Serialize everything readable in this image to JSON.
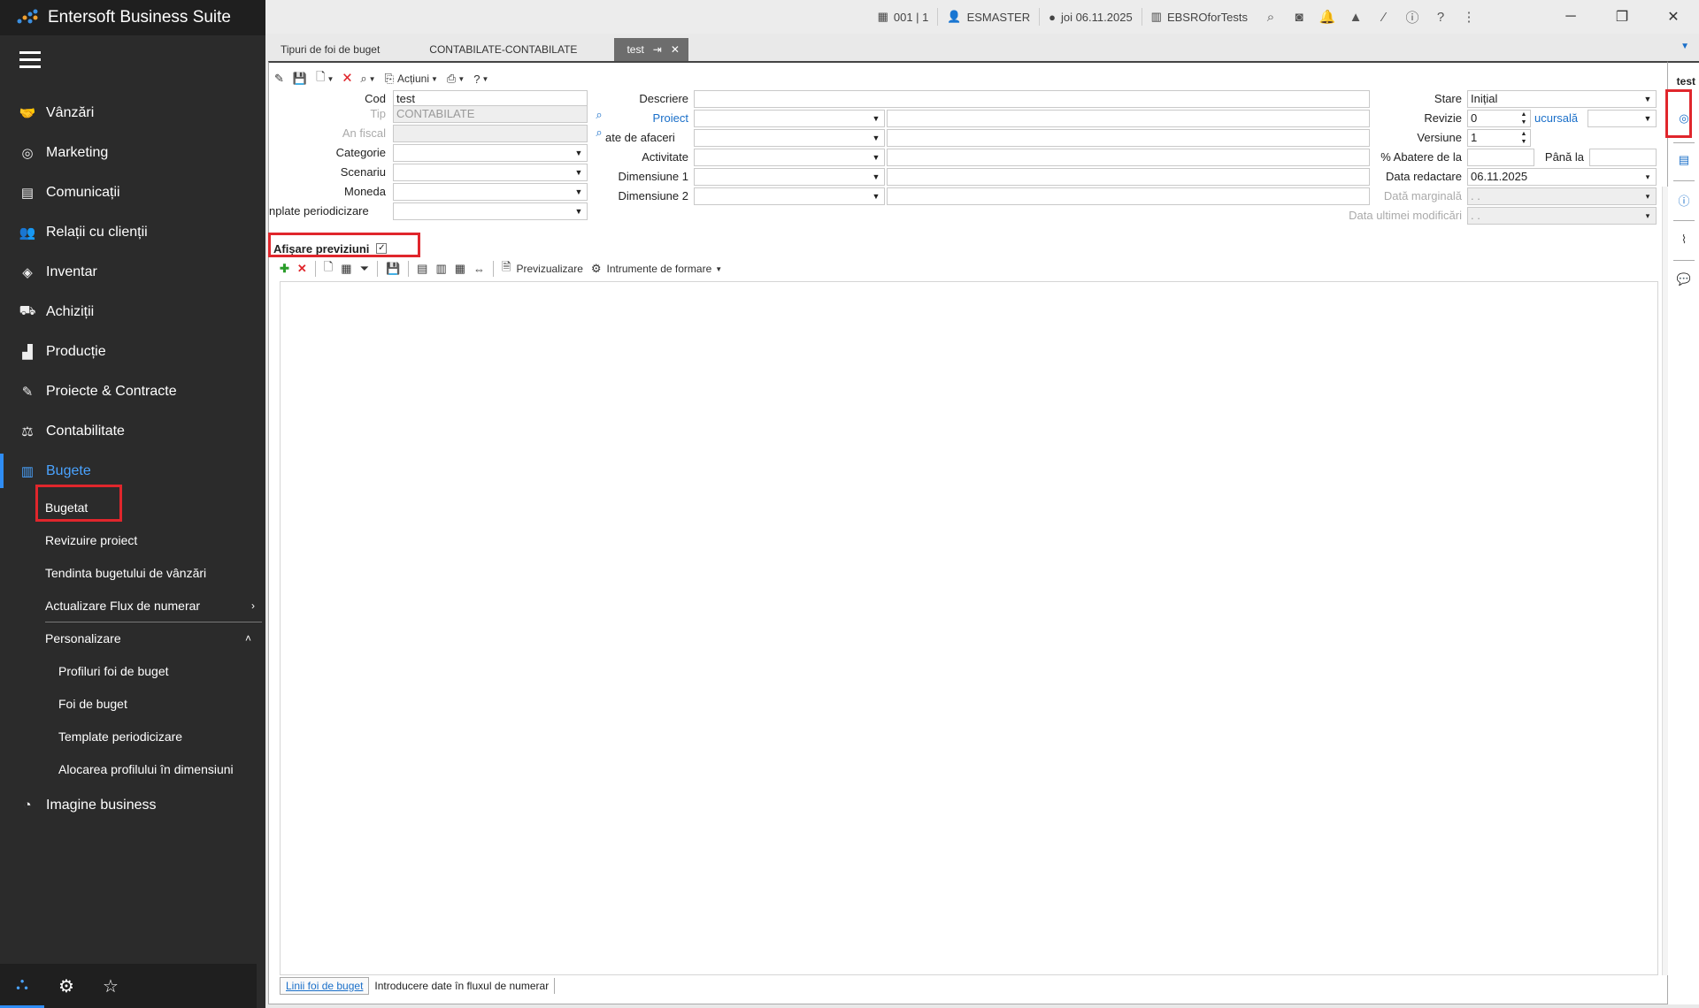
{
  "app": {
    "title": "Entersoft Business Suite"
  },
  "sidebar": {
    "items": [
      {
        "label": "Vânzări",
        "icon": "handshake-icon",
        "glyph": "🤝"
      },
      {
        "label": "Marketing",
        "icon": "target-icon",
        "glyph": "◎"
      },
      {
        "label": "Comunicații",
        "icon": "list-icon",
        "glyph": "▤"
      },
      {
        "label": "Relații cu clienții",
        "icon": "users-icon",
        "glyph": "👥"
      },
      {
        "label": "Inventar",
        "icon": "box-icon",
        "glyph": "◈"
      },
      {
        "label": "Achiziții",
        "icon": "truck-icon",
        "glyph": "⛟"
      },
      {
        "label": "Producție",
        "icon": "factory-icon",
        "glyph": "▟"
      },
      {
        "label": "Proiecte & Contracte",
        "icon": "edit-icon",
        "glyph": "✎"
      },
      {
        "label": "Contabilitate",
        "icon": "money-icon",
        "glyph": "⚖"
      },
      {
        "label": "Bugete",
        "icon": "chart-icon",
        "glyph": "▥"
      }
    ],
    "subitems": [
      {
        "label": "Bugetat"
      },
      {
        "label": "Revizuire proiect"
      },
      {
        "label": "Tendinta bugetului de vânzări"
      },
      {
        "label": "Actualizare Flux de numerar"
      },
      {
        "label": "Personalizare"
      }
    ],
    "subsubitems": [
      {
        "label": "Profiluri foi de buget"
      },
      {
        "label": "Foi de buget"
      },
      {
        "label": "Template periodicizare"
      },
      {
        "label": "Alocarea profilului în dimensiuni"
      }
    ],
    "last_item": {
      "label": "Imagine business",
      "icon": "dashboard-icon",
      "glyph": "◔"
    }
  },
  "titlebar": {
    "company": "001 | 1",
    "user": "ESMASTER",
    "date": "joi 06.11.2025",
    "database": "EBSROforTests"
  },
  "tabs": [
    {
      "label": "Tipuri de foi de buget"
    },
    {
      "label": "CONTABILATE-CONTABILATE"
    },
    {
      "label": "test"
    }
  ],
  "doc_title": "test",
  "toolbar": {
    "actions_label": "Acțiuni"
  },
  "form": {
    "cod_label": "Cod",
    "cod_value": "test",
    "tip_label": "Tip",
    "tip_value": "CONTABILATE",
    "an_fiscal_label": "An fiscal",
    "an_fiscal_value": "",
    "categorie_label": "Categorie",
    "categorie_value": "",
    "scenariu_label": "Scenariu",
    "scenariu_value": "",
    "moneda_label": "Moneda",
    "moneda_value": "",
    "template_label": "nplate periodicizare",
    "template_value": "",
    "descriere_label": "Descriere",
    "descriere_value": "",
    "proiect_label": "Proiect",
    "proiect_value": "",
    "afaceri_label": "ate de afaceri",
    "afaceri_value": "",
    "activitate_label": "Activitate",
    "activitate_value": "",
    "dim1_label": "Dimensiune 1",
    "dim1_value": "",
    "dim2_label": "Dimensiune 2",
    "dim2_value": "",
    "stare_label": "Stare",
    "stare_value": "Inițial",
    "revizie_label": "Revizie",
    "revizie_value": "0",
    "sucursala_label": "ucursală",
    "sucursala_value": "",
    "versiune_label": "Versiune",
    "versiune_value": "1",
    "abatere_label": "% Abatere de la",
    "abatere_value": "",
    "pana_label": "Până la",
    "pana_value": "",
    "data_redactare_label": "Data redactare",
    "data_redactare_value": "06.11.2025",
    "data_marginala_label": "Dată marginală",
    "data_marginala_value": "  .  .",
    "data_modificari_label": "Data ultimei modificări",
    "data_modificari_value": "  .  ."
  },
  "previziuni": {
    "label": "Afișare previziuni",
    "checked": true
  },
  "gridbar": {
    "preview_label": "Previzualizare",
    "format_label": "Intrumente de formare"
  },
  "bottom_tabs": [
    {
      "label": "Linii foi de buget"
    },
    {
      "label": "Introducere date în fluxul de numerar"
    }
  ]
}
